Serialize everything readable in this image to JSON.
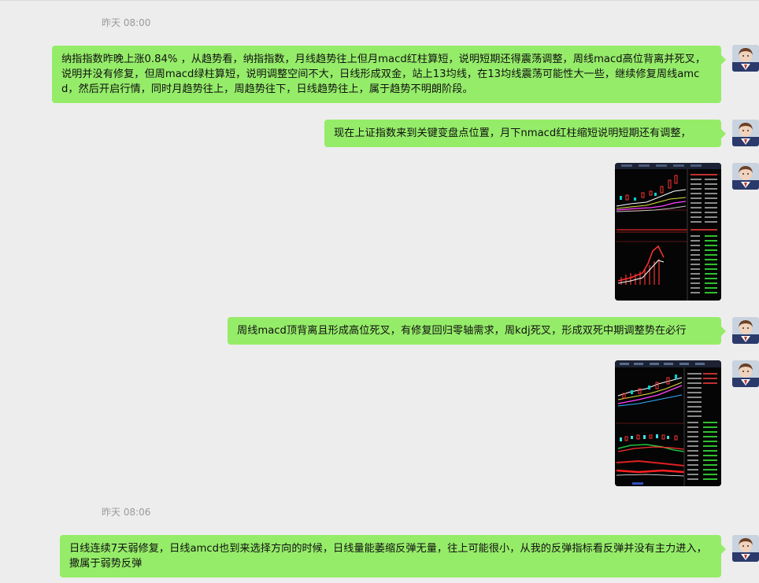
{
  "chat": {
    "timestamp1": "昨天 08:00",
    "timestamp2": "昨天 08:06",
    "messages": [
      {
        "type": "text",
        "text": "纳指指数昨晚上涨0.84% ，从趋势看，纳指指数，月线趋势往上但月macd红柱算短，说明短期还得震荡调整，周线macd高位背离并死叉，说明并没有修复，但周macd绿柱算短，说明调整空间不大，日线形成双金，站上13均线，在13均线震荡可能性大一些，继续修复周线amcd，然后开启行情，同时月趋势往上，周趋势往下，日线趋势往上，属于趋势不明朗阶段。"
      },
      {
        "type": "text",
        "text": "现在上证指数来到关键变盘点位置，月下nmacd红柱缩短说明短期还有调整，"
      },
      {
        "type": "image",
        "description": "stock-chart-screenshot-1"
      },
      {
        "type": "text",
        "text": "周线macd顶背离且形成高位死叉，有修复回归零轴需求，周kdj死叉，形成双死中期调整势在必行"
      },
      {
        "type": "image",
        "description": "stock-chart-screenshot-2"
      },
      {
        "type": "text",
        "text": "日线连续7天弱修复，日线amcd也到来选择方向的时候，日线量能萎缩反弹无量，往上可能很小，从我的反弹指标看反弹并没有主力进入，撒属于弱势反弹"
      }
    ]
  },
  "colors": {
    "background": "#ededed",
    "bubble": "#95ec69",
    "timestamp": "#9a9a9a"
  },
  "icons": {
    "avatar": "user-avatar-icon"
  }
}
